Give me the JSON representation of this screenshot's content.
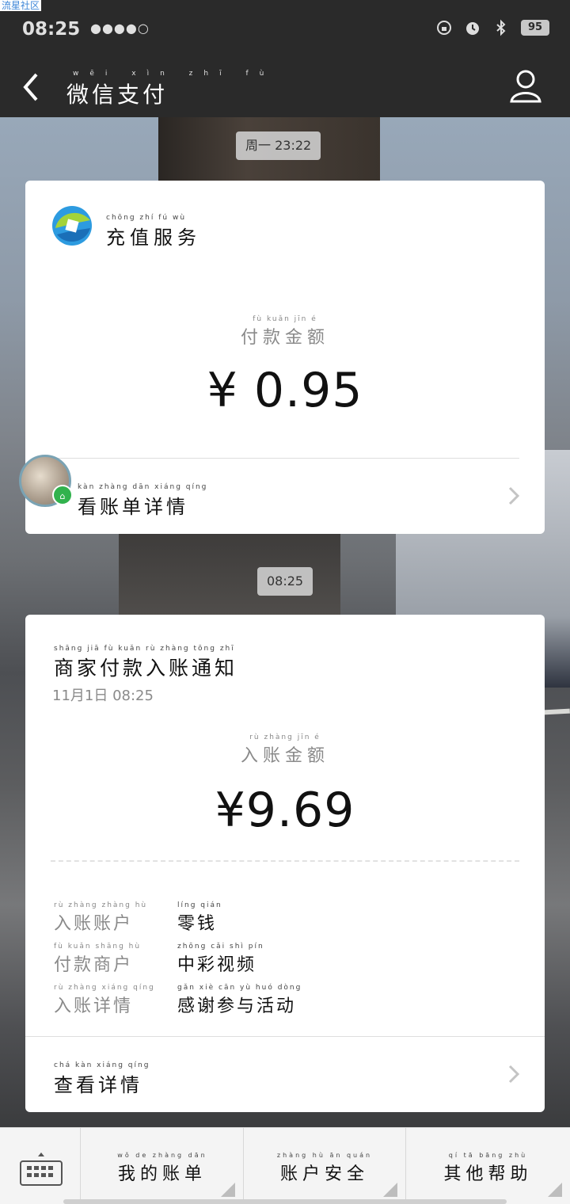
{
  "watermark": "流星社区",
  "status_bar": {
    "time": "08:25",
    "signal_dots": "●●●●○",
    "battery": "95"
  },
  "nav": {
    "title": "微信支付",
    "title_pinyin": "wēi xìn zhī fù"
  },
  "timestamps": [
    "周一 23:22",
    "08:25"
  ],
  "card1": {
    "service_name": "充值服务",
    "service_pinyin": "chōng zhí fú wù",
    "amount_label": "付款金额",
    "amount_label_pinyin": "fù kuǎn jīn é",
    "amount": "¥ 0.95",
    "link_label": "看账单详情",
    "link_pinyin": "kàn zhàng dān xiáng qíng"
  },
  "card2": {
    "title": "商家付款入账通知",
    "title_pinyin": "shāng jiā fù kuǎn rù zhàng tōng zhī",
    "date": "11月1日  08:25",
    "amount_label": "入账金额",
    "amount_label_pinyin": "rù zhàng jīn é",
    "amount": "¥9.69",
    "details": [
      {
        "key": "入账账户",
        "key_pinyin": "rù zhàng zhàng hù",
        "value": "零钱",
        "value_pinyin": "líng qián"
      },
      {
        "key": "付款商户",
        "key_pinyin": "fù kuǎn shāng hù",
        "value": "中彩视频",
        "value_pinyin": "zhōng cǎi shì pín"
      },
      {
        "key": "入账详情",
        "key_pinyin": "rù zhàng xiáng qíng",
        "value": "感谢参与活动",
        "value_pinyin": "gǎn xiè cān yù huó dòng"
      }
    ],
    "link_label": "查看详情",
    "link_pinyin": "chá kàn xiáng qíng"
  },
  "bottom_menu": [
    {
      "label": "我的账单",
      "pinyin": "wǒ de zhàng dān"
    },
    {
      "label": "账户安全",
      "pinyin": "zhàng hù ān quán"
    },
    {
      "label": "其他帮助",
      "pinyin": "qí tā bāng zhù"
    }
  ],
  "colors": {
    "nav_bg": "#2a2a2a",
    "card_bg": "#ffffff",
    "badge_green": "#31b24d"
  }
}
